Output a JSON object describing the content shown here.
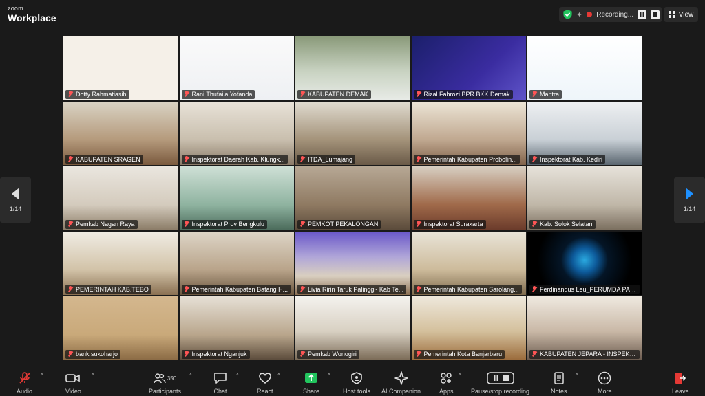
{
  "app": {
    "brand_small": "zoom",
    "brand_big": "Workplace"
  },
  "topbar": {
    "recording_label": "Recording...",
    "view_label": "View"
  },
  "pagination": {
    "left": "1/14",
    "right": "1/14"
  },
  "tiles": [
    {
      "name": "Dotty Rahmatiasih",
      "active": true
    },
    {
      "name": "Rani Thufaila Yofanda"
    },
    {
      "name": "KABUPATEN DEMAK"
    },
    {
      "name": "Rizal Fahrozi BPR BKK Demak"
    },
    {
      "name": "Mantra"
    },
    {
      "name": "KABUPATEN SRAGEN"
    },
    {
      "name": "Inspektorat Daerah Kab. Klungk..."
    },
    {
      "name": "ITDA_Lumajang"
    },
    {
      "name": "Pemerintah Kabupaten Probolin..."
    },
    {
      "name": "Inspektorat Kab. Kediri"
    },
    {
      "name": "Pemkab Nagan Raya"
    },
    {
      "name": "Inspektorat Prov Bengkulu"
    },
    {
      "name": "PEMKOT PEKALONGAN"
    },
    {
      "name": "Inspektorat Surakarta"
    },
    {
      "name": "Kab. Solok Selatan"
    },
    {
      "name": "PEMERINTAH KAB.TEBO"
    },
    {
      "name": "Pemerintah Kabupaten Batang H..."
    },
    {
      "name": "Livia Ririn Taruk Palinggi- Kab Te..."
    },
    {
      "name": "Pemerintah Kabupaten Sarolang..."
    },
    {
      "name": "Ferdinandus Leu_PERUMDA PAS..."
    },
    {
      "name": "bank sukoharjo"
    },
    {
      "name": "Inspektorat Nganjuk"
    },
    {
      "name": "Pemkab Wonogiri"
    },
    {
      "name": "Pemerintah Kota Banjarbaru"
    },
    {
      "name": "KABUPATEN JEPARA - INSPEKTUR"
    }
  ],
  "toolbar": {
    "audio": "Audio",
    "video": "Video",
    "participants": "Participants",
    "participants_count": "350",
    "chat": "Chat",
    "react": "React",
    "share": "Share",
    "host_tools": "Host tools",
    "ai_companion": "AI Companion",
    "apps": "Apps",
    "pause_stop": "Pause/stop recording",
    "notes": "Notes",
    "more": "More",
    "leave": "Leave"
  },
  "colors": {
    "active_border": "#4cd964",
    "share_green": "#22c55e",
    "leave_red": "#e53935",
    "accent_blue": "#1e90ff"
  }
}
